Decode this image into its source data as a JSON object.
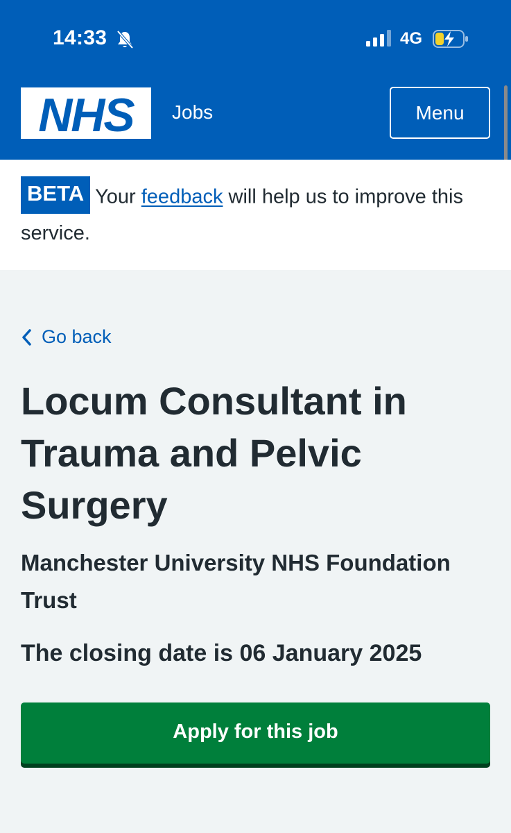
{
  "status_bar": {
    "time": "14:33",
    "network": "4G",
    "icons": [
      "bell-slash-icon",
      "signal-icon",
      "battery-charging-icon"
    ]
  },
  "header": {
    "logo_text": "NHS",
    "service_name": "Jobs",
    "menu_label": "Menu",
    "brand_color": "#005eb8"
  },
  "banner": {
    "tag": "BETA",
    "text_before": "Your ",
    "link_text": "feedback",
    "text_after": " will help us to improve this service."
  },
  "back_link": {
    "icon": "chevron-left-icon",
    "label": "Go back"
  },
  "job": {
    "title": "Locum Consultant in Trauma and Pelvic Surgery",
    "employer": "Manchester University NHS Foundation Trust",
    "closing_text": "The closing date is 06 January 2025"
  },
  "apply_button": {
    "label": "Apply for this job",
    "color": "#007f3b"
  },
  "colors": {
    "page_background": "#f0f4f5",
    "text": "#212b32",
    "link": "#005eb8"
  }
}
